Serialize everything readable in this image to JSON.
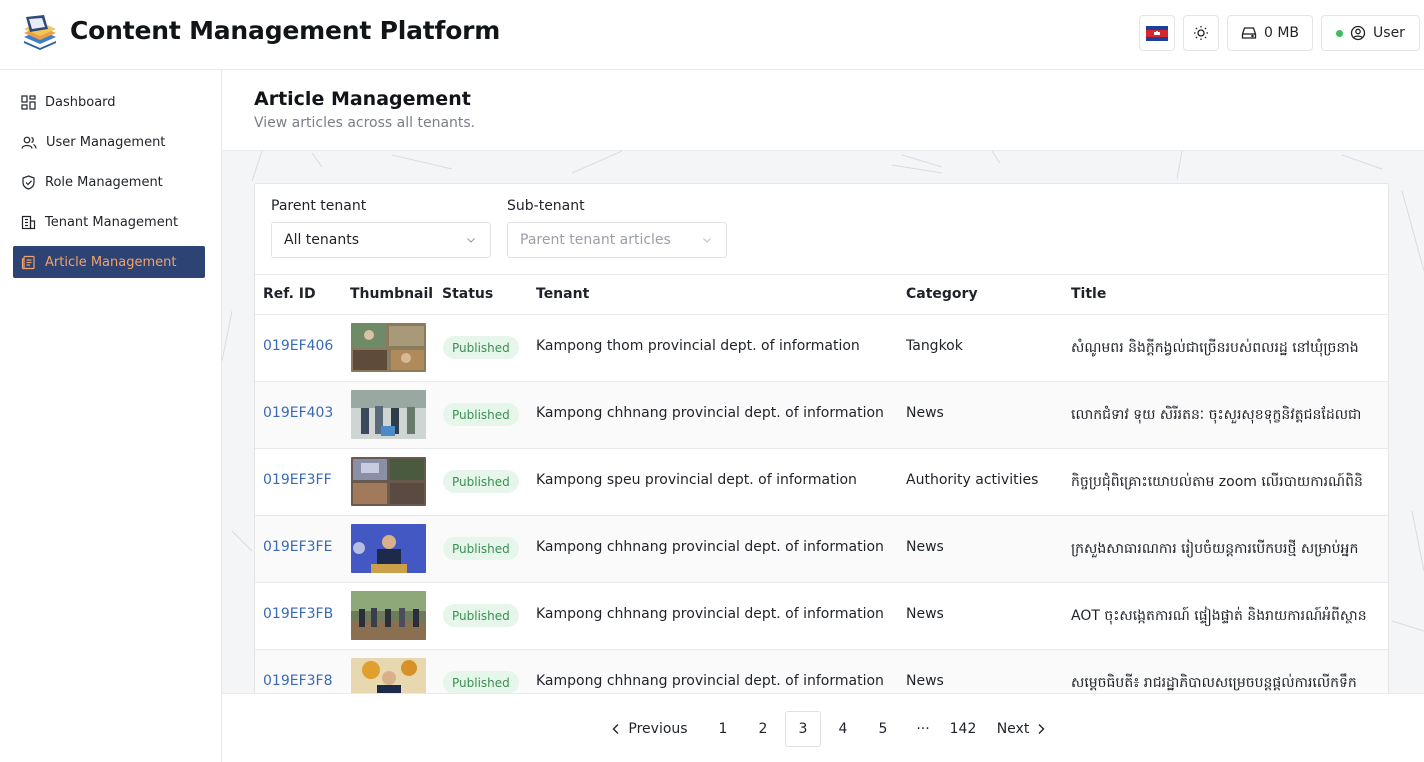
{
  "header": {
    "title": "Content Management Platform",
    "storage_label": "0 MB",
    "user_label": "User"
  },
  "sidebar": {
    "items": [
      {
        "label": "Dashboard",
        "icon": "dashboard-icon"
      },
      {
        "label": "User Management",
        "icon": "users-icon"
      },
      {
        "label": "Role Management",
        "icon": "shield-check-icon"
      },
      {
        "label": "Tenant Management",
        "icon": "building-icon"
      },
      {
        "label": "Article Management",
        "icon": "article-icon",
        "active": true
      }
    ]
  },
  "page": {
    "title": "Article Management",
    "subtitle": "View articles across all tenants."
  },
  "filters": {
    "parent_label": "Parent tenant",
    "parent_value": "All tenants",
    "sub_label": "Sub-tenant",
    "sub_placeholder": "Parent tenant articles"
  },
  "table": {
    "columns": [
      "Ref. ID",
      "Thumbnail",
      "Status",
      "Tenant",
      "Category",
      "Title"
    ],
    "rows": [
      {
        "ref": "019EF406",
        "status": "Published",
        "tenant": "Kampong thom provincial dept. of information",
        "category": "Tangkok",
        "title": "សំណូមពរ និងក្ដីកង្វល់ជាច្រើនរបស់ពលរដ្ឋ នៅឃុំច្រនាង"
      },
      {
        "ref": "019EF403",
        "status": "Published",
        "tenant": "Kampong chhnang provincial dept. of information",
        "category": "News",
        "title": "លោកជំទាវ ទុយ សិរីរតនៈ ចុះសួរសុខទុក្ខនិវត្តជនដែលជា"
      },
      {
        "ref": "019EF3FF",
        "status": "Published",
        "tenant": "Kampong speu provincial dept. of information",
        "category": "Authority activities",
        "title": "កិច្ចប្រជុំពិគ្រោះយោបល់តាម zoom លើរបាយការណ៍ពិនិ"
      },
      {
        "ref": "019EF3FE",
        "status": "Published",
        "tenant": "Kampong chhnang provincial dept. of information",
        "category": "News",
        "title": "ក្រសួងសាធារណការ រៀបចំយន្តការបើកបរថ្មី សម្រាប់អ្នក"
      },
      {
        "ref": "019EF3FB",
        "status": "Published",
        "tenant": "Kampong chhnang provincial dept. of information",
        "category": "News",
        "title": "AOT ចុះសង្កេតការណ៍ ផ្ទៀងផ្ទាត់ និងរាយការណ៍អំពីស្ថាន"
      },
      {
        "ref": "019EF3F8",
        "status": "Published",
        "tenant": "Kampong chhnang provincial dept. of information",
        "category": "News",
        "title": "សម្ដេចធិបតី៖ រាជរដ្ឋាភិបាលសម្រេចបន្តផ្ដល់ការលើកទឹក"
      }
    ]
  },
  "pagination": {
    "previous": "Previous",
    "next": "Next",
    "pages": [
      "1",
      "2",
      "3",
      "4",
      "5",
      "···",
      "142"
    ],
    "current": "3"
  },
  "colors": {
    "accent_nav": "#2d4373",
    "accent_nav_text": "#f2a36b",
    "link": "#3b6ab5",
    "badge_bg": "#e6f6ea",
    "badge_text": "#3a8f53",
    "online": "#3dbb63"
  }
}
